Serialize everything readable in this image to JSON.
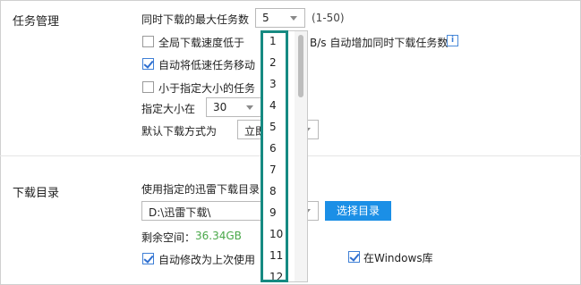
{
  "sections": {
    "task_management": "任务管理",
    "download_dir": "下载目录"
  },
  "max_tasks": {
    "label": "同时下载的最大任务数",
    "value": "5",
    "range": "(1-50)"
  },
  "global_speed": {
    "label": "全局下载速度低于",
    "suffix": "B/s 自动增加同时下载任务数",
    "checked": false
  },
  "auto_move": {
    "label": "自动将低速任务移动",
    "checked": true
  },
  "small_task": {
    "label": "小于指定大小的任务",
    "checked": false
  },
  "size_spec": {
    "label": "指定大小在",
    "value": "30"
  },
  "default_mode": {
    "label": "默认下载方式为",
    "value": "立即"
  },
  "dropdown": {
    "options": [
      "1",
      "2",
      "3",
      "4",
      "5",
      "6",
      "7",
      "8",
      "9",
      "10",
      "11",
      "12"
    ]
  },
  "dir": {
    "use_label": "使用指定的迅雷下载目录",
    "path": "D:\\迅雷下载\\",
    "select_button": "选择目录",
    "free_label": "剩余空间：",
    "free_value": "36.34GB"
  },
  "auto_modify": {
    "label": "自动修改为上次使用",
    "checked": true
  },
  "windows_lib": {
    "label": "在Windows库",
    "checked": true
  },
  "colors": {
    "accent": "#1b8fe6",
    "highlight": "#168a82",
    "free_space": "#4aa84a"
  }
}
